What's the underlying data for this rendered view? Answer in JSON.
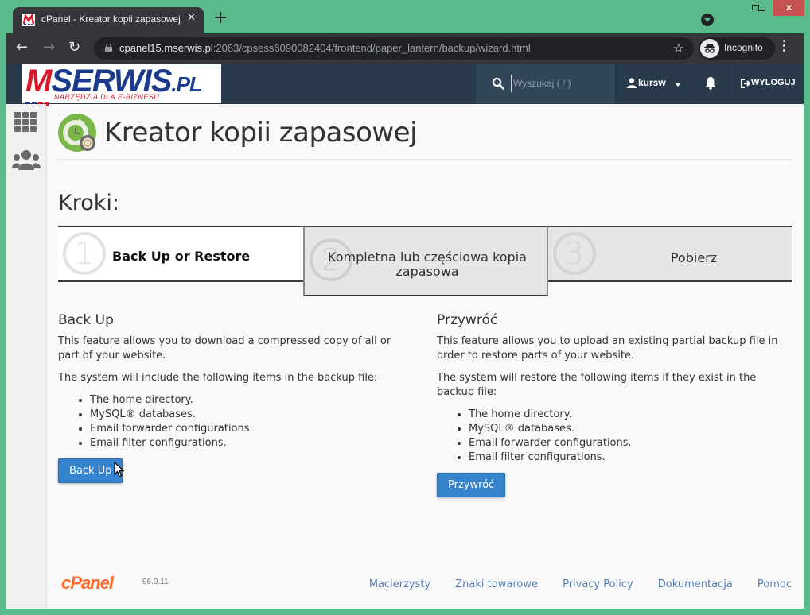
{
  "browser": {
    "tab_title": "cPanel - Kreator kopii zapasowej",
    "url_host": "cpanel15.mserwis.pl",
    "url_path": ":2083/cpsess6090082404/frontend/paper_lantern/backup/wizard.html",
    "incognito_label": "Incognito",
    "new_tab_glyph": "+",
    "close_tab_glyph": "✕",
    "back_glyph": "←",
    "forward_glyph": "→",
    "reload_glyph": "↻",
    "star_glyph": "☆",
    "window_close_glyph": "✕"
  },
  "topbar": {
    "logo_main_m": "M",
    "logo_main_rest": "SERWIS",
    "logo_main_pl": ".PL",
    "logo_sub": "NARZĘDZIA DLA E-BIZNESU",
    "search_placeholder": "Wyszukaj ( / )",
    "search_value": "",
    "user_name": "kursw",
    "logout_label": "WYLOGUJ"
  },
  "page": {
    "title": "Kreator kopii zapasowej",
    "steps_heading": "Kroki:",
    "steps": [
      {
        "number": "1",
        "label": "Back Up or Restore",
        "state": "active"
      },
      {
        "number": "2",
        "label": "Kompletna lub częściowa kopia zapasowa",
        "state": "inactive"
      },
      {
        "number": "3",
        "label": "Pobierz",
        "state": "inactive"
      }
    ]
  },
  "backup": {
    "heading": "Back Up",
    "description": "This feature allows you to download a compressed copy of all or part of your website.",
    "intro": "The system will include the following items in the backup file:",
    "items": [
      "The home directory.",
      "MySQL® databases.",
      "Email forwarder configurations.",
      "Email filter configurations."
    ],
    "button_label": "Back Up"
  },
  "restore": {
    "heading": "Przywróć",
    "description": "This feature allows you to upload an existing partial backup file in order to restore parts of your website.",
    "intro": "The system will restore the following items if they exist in the backup file:",
    "items": [
      "The home directory.",
      "MySQL® databases.",
      "Email forwarder configurations.",
      "Email filter configurations."
    ],
    "button_label": "Przywróć"
  },
  "footer": {
    "logo_text": "cPanel",
    "version": "96.0.11",
    "links": [
      "Macierzysty",
      "Znaki towarowe",
      "Privacy Policy",
      "Dokumentacja",
      "Pomoc"
    ]
  },
  "colors": {
    "window_frame": "#5bba8a",
    "topbar_bg": "#293a4a",
    "primary_button": "#3583cc",
    "link": "#5480b5",
    "cpanel_orange": "#ff6c2c"
  }
}
